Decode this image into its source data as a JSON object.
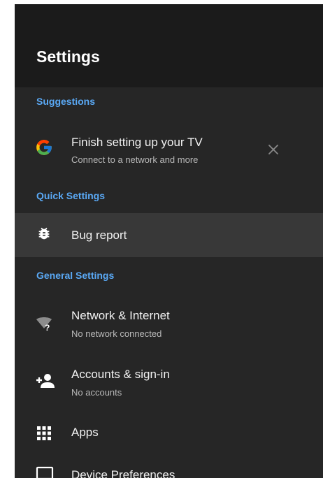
{
  "header": {
    "title": "Settings"
  },
  "sections": {
    "suggestions": "Suggestions",
    "quick_settings": "Quick Settings",
    "general_settings": "General Settings"
  },
  "suggestion": {
    "icon": "google-g-icon",
    "title": "Finish setting up your TV",
    "subtitle": "Connect to a network and more"
  },
  "quick": {
    "bug_report": {
      "icon": "bug-icon",
      "title": "Bug report"
    }
  },
  "general": {
    "network": {
      "icon": "wifi-question-icon",
      "title": "Network & Internet",
      "subtitle": "No network connected"
    },
    "accounts": {
      "icon": "add-person-icon",
      "title": "Accounts & sign-in",
      "subtitle": "No accounts"
    },
    "apps": {
      "icon": "apps-grid-icon",
      "title": "Apps"
    },
    "device_prefs": {
      "icon": "tv-icon",
      "title": "Device Preferences"
    }
  },
  "colors": {
    "accent": "#5aa9f5",
    "background": "#262626",
    "header_background": "#1b1b1b",
    "selected_row": "#383838"
  }
}
